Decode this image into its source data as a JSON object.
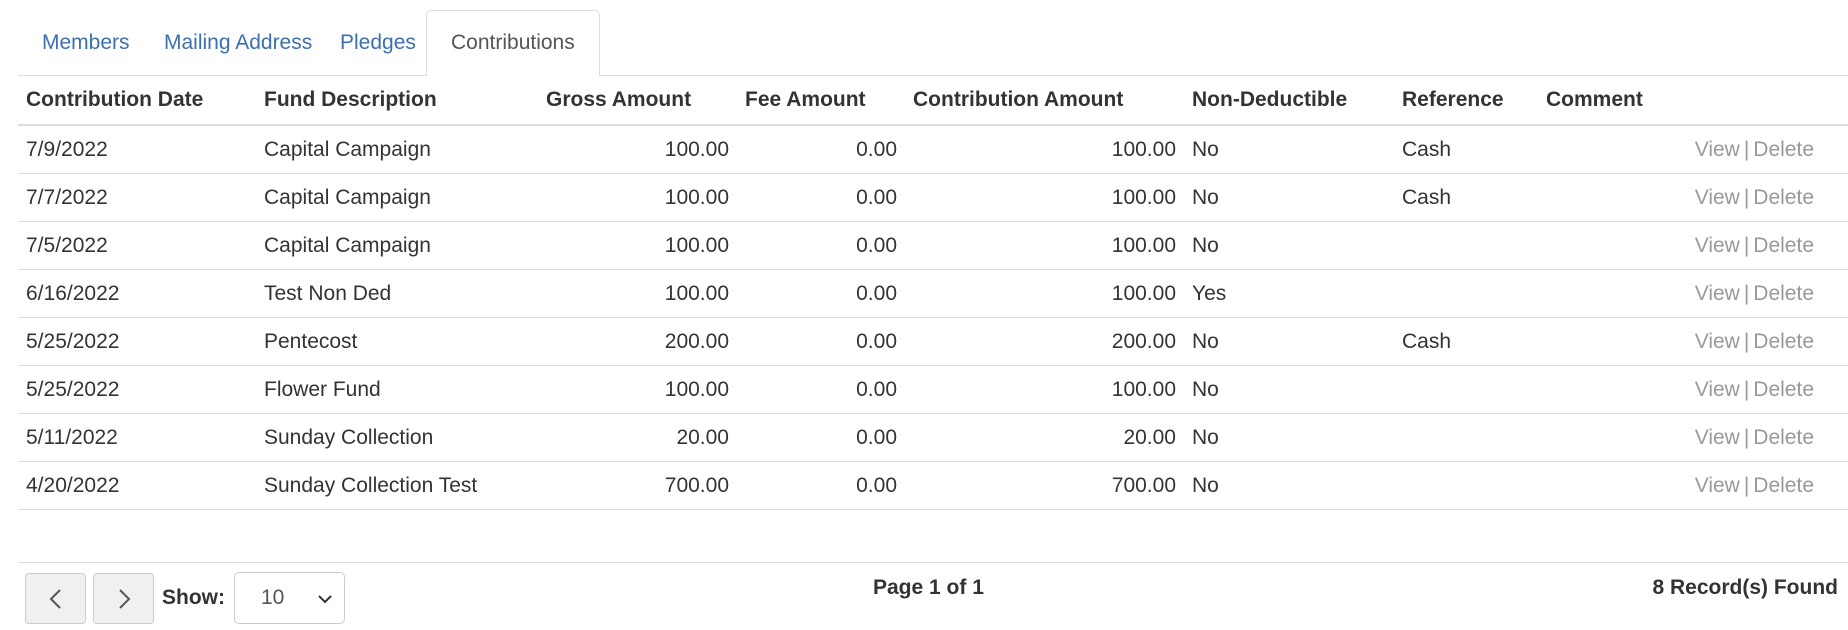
{
  "tabs": [
    {
      "label": "Members"
    },
    {
      "label": "Mailing Address"
    },
    {
      "label": "Pledges"
    },
    {
      "label": "Contributions"
    }
  ],
  "active_tab": "Contributions",
  "table": {
    "headers": [
      "Contribution Date",
      "Fund Description",
      "Gross Amount",
      "Fee Amount",
      "Contribution Amount",
      "Non-Deductible",
      "Reference",
      "Comment"
    ],
    "rows": [
      {
        "date": "7/9/2022",
        "fund": "Capital Campaign",
        "gross": "100.00",
        "fee": "0.00",
        "amount": "100.00",
        "nondeductible": "No",
        "reference": "Cash",
        "comment": ""
      },
      {
        "date": "7/7/2022",
        "fund": "Capital Campaign",
        "gross": "100.00",
        "fee": "0.00",
        "amount": "100.00",
        "nondeductible": "No",
        "reference": "Cash",
        "comment": ""
      },
      {
        "date": "7/5/2022",
        "fund": "Capital Campaign",
        "gross": "100.00",
        "fee": "0.00",
        "amount": "100.00",
        "nondeductible": "No",
        "reference": "",
        "comment": ""
      },
      {
        "date": "6/16/2022",
        "fund": "Test Non Ded",
        "gross": "100.00",
        "fee": "0.00",
        "amount": "100.00",
        "nondeductible": "Yes",
        "reference": "",
        "comment": ""
      },
      {
        "date": "5/25/2022",
        "fund": "Pentecost",
        "gross": "200.00",
        "fee": "0.00",
        "amount": "200.00",
        "nondeductible": "No",
        "reference": "Cash",
        "comment": ""
      },
      {
        "date": "5/25/2022",
        "fund": "Flower Fund",
        "gross": "100.00",
        "fee": "0.00",
        "amount": "100.00",
        "nondeductible": "No",
        "reference": "",
        "comment": ""
      },
      {
        "date": "5/11/2022",
        "fund": "Sunday Collection",
        "gross": "20.00",
        "fee": "0.00",
        "amount": "20.00",
        "nondeductible": "No",
        "reference": "",
        "comment": ""
      },
      {
        "date": "4/20/2022",
        "fund": "Sunday Collection Test",
        "gross": "700.00",
        "fee": "0.00",
        "amount": "700.00",
        "nondeductible": "No",
        "reference": "",
        "comment": ""
      }
    ],
    "view_label": "View",
    "action_separator": "|",
    "delete_label": "Delete"
  },
  "pager": {
    "prev_icon": "chevron-left-icon",
    "next_icon": "chevron-right-icon",
    "show_label": "Show:",
    "page_size": "10",
    "page_info": "Page 1 of 1",
    "records_found": "8 Record(s) Found"
  }
}
